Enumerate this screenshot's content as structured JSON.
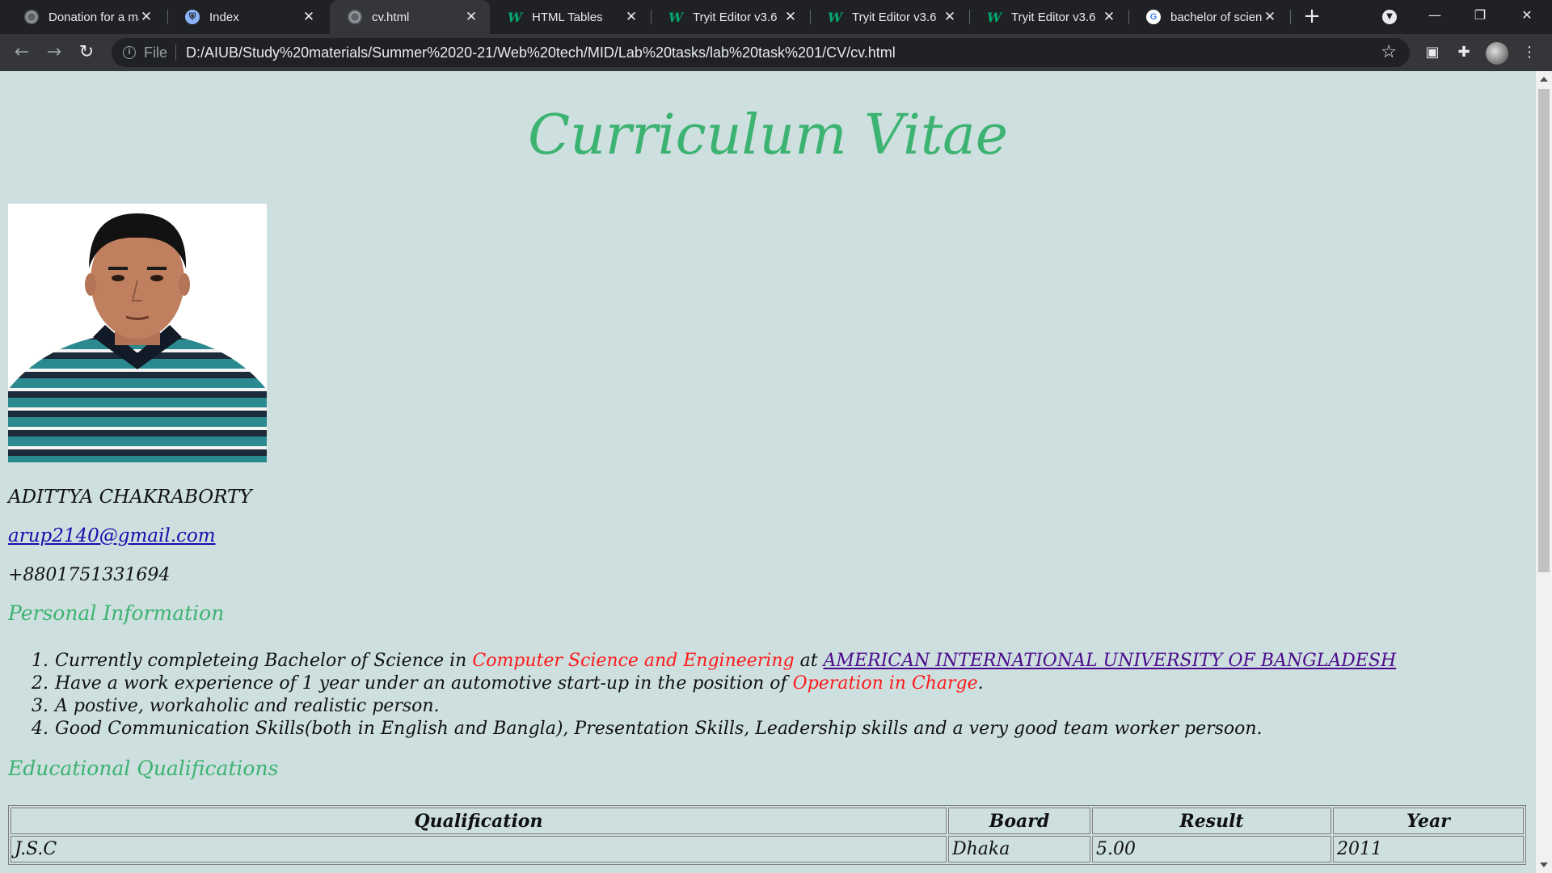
{
  "browser": {
    "tabs": [
      {
        "title": "Donation for a ma",
        "favicon": "globe-icon"
      },
      {
        "title": "Index",
        "favicon": "shield-icon"
      },
      {
        "title": "cv.html",
        "favicon": "globe-icon"
      },
      {
        "title": "HTML Tables",
        "favicon": "w3schools-icon"
      },
      {
        "title": "Tryit Editor v3.6",
        "favicon": "w3schools-icon"
      },
      {
        "title": "Tryit Editor v3.6",
        "favicon": "w3schools-icon"
      },
      {
        "title": "Tryit Editor v3.6",
        "favicon": "w3schools-icon"
      },
      {
        "title": "bachelor of scienc",
        "favicon": "google-icon"
      }
    ],
    "active_tab": 2,
    "address": {
      "scheme": "File",
      "url": "D:/AIUB/Study%20materials/Summer%2020-21/Web%20tech/MID/Lab%20tasks/lab%20task%201/CV/cv.html"
    }
  },
  "page": {
    "title": "Curriculum Vitae",
    "name": "ADITTYA CHAKRABORTY",
    "email": "arup2140@gmail.com",
    "phone": "+8801751331694",
    "personal_heading": "Personal Information",
    "personal_items": [
      {
        "num": "1.",
        "pre": "Currently completeing Bachelor of Science in ",
        "highlight": "Computer Science and Engineering",
        "mid": " at ",
        "link": "AMERICAN INTERNATIONAL UNIVERSITY OF BANGLADESH"
      },
      {
        "num": "2.",
        "pre": "Have a work experience of 1 year under an automotive start-up in the position of ",
        "highlight": "Operation in Charge",
        "post": "."
      },
      {
        "num": "3.",
        "text": "A postive, workaholic and realistic person."
      },
      {
        "num": "4.",
        "text": "Good Communication Skills(both in English and Bangla), Presentation Skills, Leadership skills and a very good team worker persoon."
      }
    ],
    "education_heading": "Educational Qualifications",
    "education_table": {
      "headers": [
        "Qualification",
        "Board",
        "Result",
        "Year"
      ],
      "rows": [
        [
          "J.S.C",
          "Dhaka",
          "5.00",
          "2011"
        ]
      ]
    }
  },
  "colors": {
    "page_bg": "#cddfdf",
    "heading_green": "#3cb371",
    "highlight_red": "#ff1a1a",
    "link_blue": "#1a0dab",
    "visited_purple": "#4b0a8c"
  }
}
